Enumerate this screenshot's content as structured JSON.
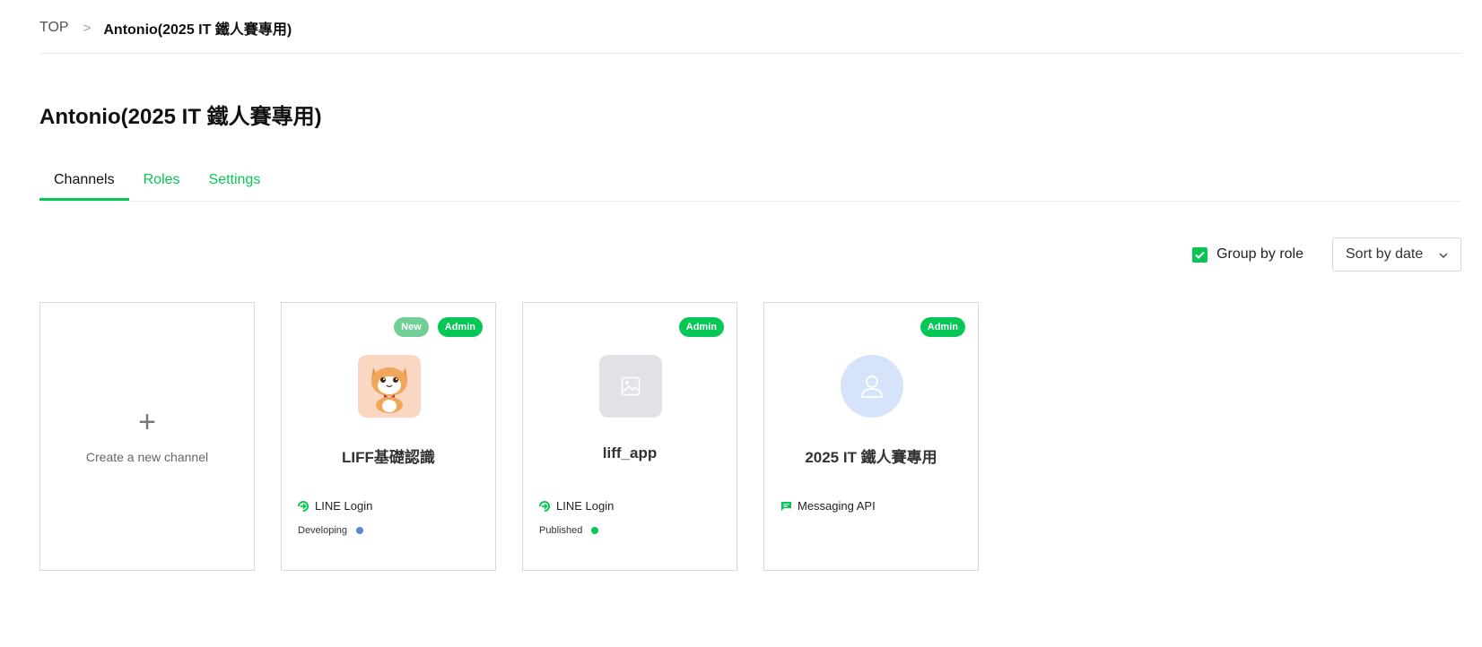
{
  "breadcrumb": {
    "top": "TOP",
    "separator": ">",
    "current": "Antonio(2025 IT 鐵人賽專用)"
  },
  "page": {
    "title": "Antonio(2025 IT 鐵人賽專用)"
  },
  "tabs": [
    {
      "label": "Channels",
      "active": true
    },
    {
      "label": "Roles",
      "active": false
    },
    {
      "label": "Settings",
      "active": false
    }
  ],
  "toolbar": {
    "group_by_role_label": "Group by role",
    "group_by_role_checked": true,
    "sort_selected": "Sort by date"
  },
  "create_card": {
    "plus": "+",
    "label": "Create a new channel"
  },
  "channels": [
    {
      "name": "LIFF基礎認識",
      "badges": [
        "New",
        "Admin"
      ],
      "icon": "cat-avatar",
      "type": "LINE Login",
      "type_icon": "line-login-icon",
      "status": "Developing",
      "status_color": "#5b84d6"
    },
    {
      "name": "liff_app",
      "badges": [
        "Admin"
      ],
      "icon": "image-placeholder",
      "type": "LINE Login",
      "type_icon": "line-login-icon",
      "status": "Published",
      "status_color": "#06c755"
    },
    {
      "name": "2025 IT 鐵人賽專用",
      "badges": [
        "Admin"
      ],
      "icon": "user-placeholder",
      "type": "Messaging API",
      "type_icon": "message-icon",
      "status": "",
      "status_color": ""
    }
  ],
  "colors": {
    "brand": "#06c755",
    "developing": "#5b84d6",
    "published": "#06c755"
  }
}
